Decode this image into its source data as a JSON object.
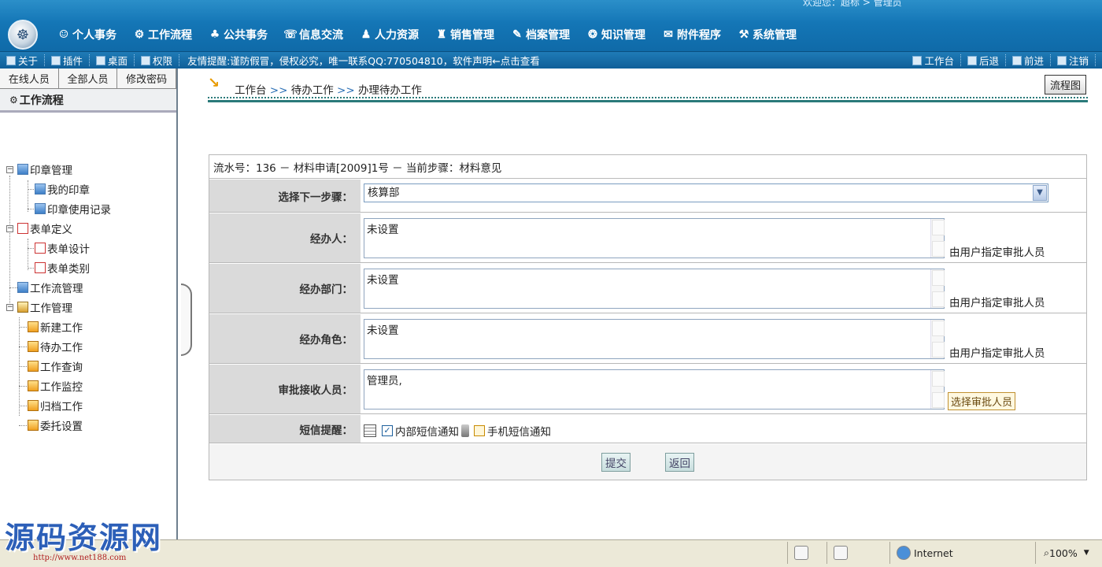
{
  "header": {
    "welcome": "欢迎您：超标 > 管理员",
    "nav": [
      {
        "label": "个人事务",
        "icon": "person-icon"
      },
      {
        "label": "工作流程",
        "icon": "flow-icon"
      },
      {
        "label": "公共事务",
        "icon": "people-icon"
      },
      {
        "label": "信息交流",
        "icon": "chat-icon"
      },
      {
        "label": "人力资源",
        "icon": "hr-icon"
      },
      {
        "label": "销售管理",
        "icon": "sales-icon"
      },
      {
        "label": "档案管理",
        "icon": "archive-icon"
      },
      {
        "label": "知识管理",
        "icon": "knowledge-icon"
      },
      {
        "label": "附件程序",
        "icon": "attachment-icon"
      },
      {
        "label": "系统管理",
        "icon": "system-icon"
      }
    ]
  },
  "toolbar": {
    "items": [
      "关于",
      "插件",
      "桌面",
      "权限"
    ],
    "notice": "友情提醒:谨防假冒，侵权必究，唯一联系QQ:770504810，软件声明←点击查看",
    "right": [
      "工作台",
      "后退",
      "前进",
      "注销"
    ]
  },
  "sidebar": {
    "tabs": [
      "在线人员",
      "全部人员",
      "修改密码"
    ],
    "title": "工作流程",
    "tree": {
      "seal": "印章管理",
      "my_seal": "我的印章",
      "seal_log": "印章使用记录",
      "form_def": "表单定义",
      "form_design": "表单设计",
      "form_type": "表单类别",
      "flow_mgmt": "工作流管理",
      "work_mgmt": "工作管理",
      "new_work": "新建工作",
      "todo_work": "待办工作",
      "work_query": "工作查询",
      "work_monitor": "工作监控",
      "archive_work": "归档工作",
      "delegate": "委托设置"
    }
  },
  "main": {
    "breadcrumb": {
      "c1": "工作台",
      "sep": ">>",
      "c2": "待办工作",
      "c3": "办理待办工作"
    },
    "flow_chart_button": "流程图",
    "form_header": "流水号：136 － 材料申请[2009]1号 － 当前步骤：材料意见",
    "rows": {
      "next_step": {
        "label": "选择下一步骤：",
        "value": "核算部"
      },
      "handler": {
        "label": "经办人：",
        "value": "未设置",
        "hint": "由用户指定审批人员"
      },
      "dept": {
        "label": "经办部门：",
        "value": "未设置",
        "hint": "由用户指定审批人员"
      },
      "role": {
        "label": "经办角色：",
        "value": "未设置",
        "hint": "由用户指定审批人员"
      },
      "receiver": {
        "label": "审批接收人员：",
        "value": "管理员,",
        "select_button": "选择审批人员"
      },
      "sms": {
        "label": "短信提醒：",
        "internal": "内部短信通知",
        "mobile": "手机短信通知",
        "internal_checked": true,
        "mobile_checked": false
      }
    },
    "submit": "提交",
    "back": "返回"
  },
  "statusbar": {
    "zone": "Internet",
    "zoom": "100%"
  },
  "watermark": {
    "text": "源码资源网",
    "url": "http://www.net188.com"
  }
}
